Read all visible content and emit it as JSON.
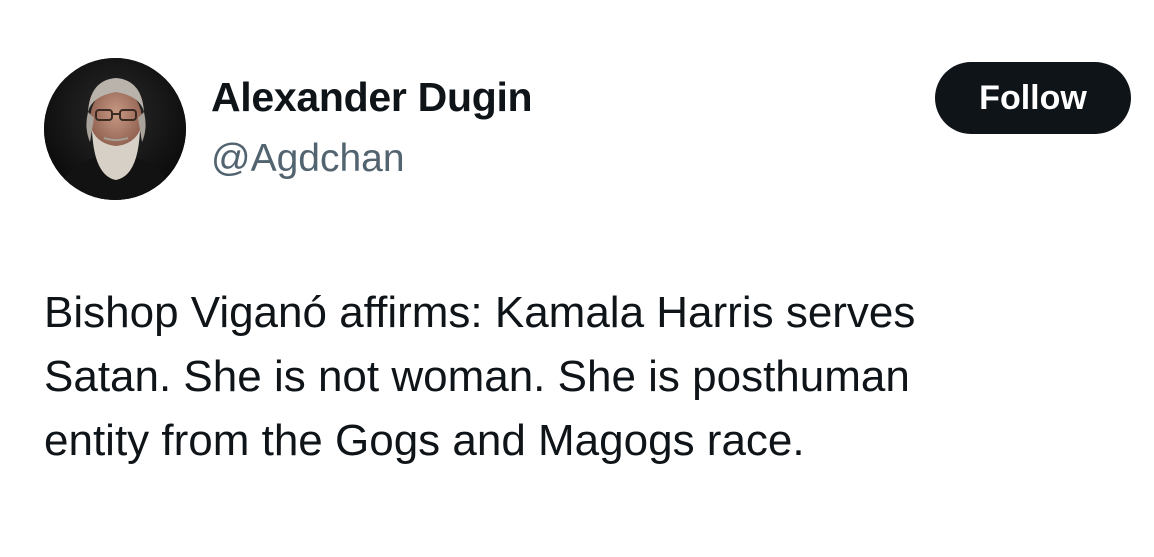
{
  "author": {
    "display_name": "Alexander Dugin",
    "handle": "@Agdchan",
    "avatar_icon": "user-avatar-photo"
  },
  "follow_button": {
    "label": "Follow",
    "background": "#0f1419",
    "text_color": "#ffffff"
  },
  "tweet": {
    "lines": [
      "Bishop Viganó affirms: Kamala Harris serves",
      "Satan. She is not woman. She is posthuman",
      "entity from the Gogs and Magogs race."
    ]
  },
  "colors": {
    "primary_text": "#0f1419",
    "secondary_text": "#536471",
    "background": "#ffffff"
  }
}
